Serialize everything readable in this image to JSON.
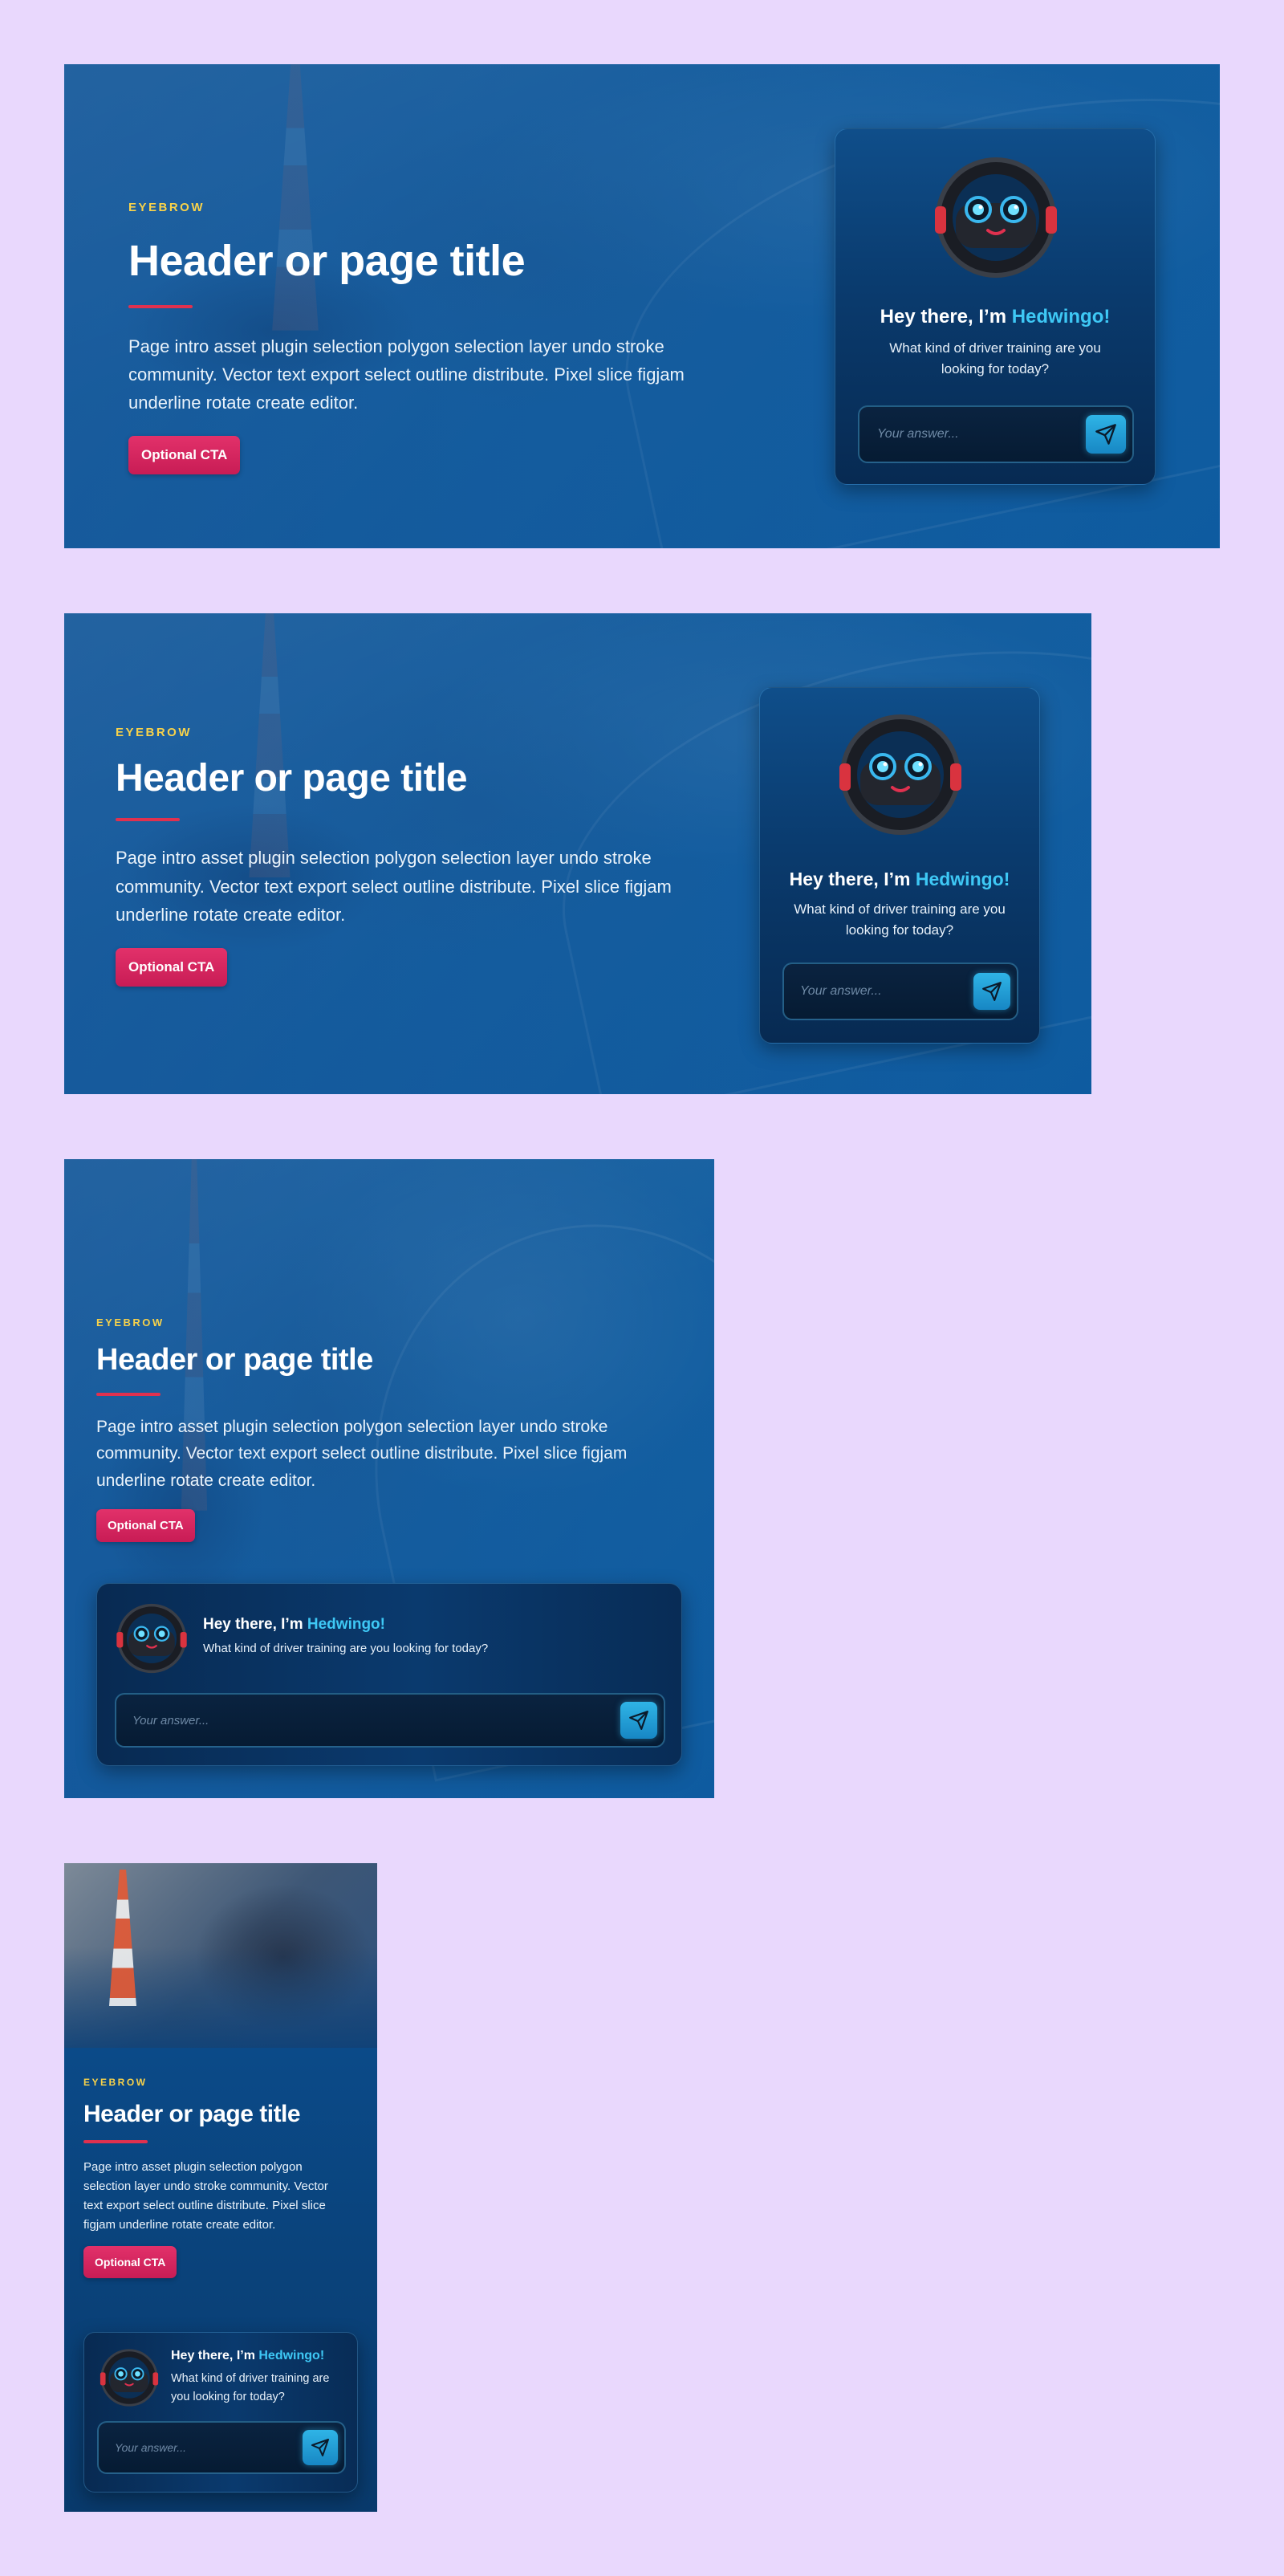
{
  "hero": {
    "eyebrow": "EYEBROW",
    "title": "Header or page title",
    "intro": "Page intro asset plugin selection polygon selection layer undo stroke community. Vector text export select outline distribute. Pixel slice figjam underline rotate create editor.",
    "cta_label": "Optional CTA"
  },
  "chat": {
    "greeting_prefix": "Hey there, I’m ",
    "bot_name": "Hedwingo!",
    "question": "What kind of driver training are you looking for today?",
    "placeholder": "Your answer...",
    "send_icon": "paper-plane-icon",
    "mascot_icon": "steering-wheel-mascot-icon"
  },
  "colors": {
    "page_bg": "#e9d8fd",
    "hero_blue": "#0d5a9c",
    "eyebrow": "#f8d24a",
    "accent_rule": "#e0314f",
    "cta": "#d4255f",
    "bot_name": "#3ec8f5",
    "send_button": "#1f9ed6"
  }
}
